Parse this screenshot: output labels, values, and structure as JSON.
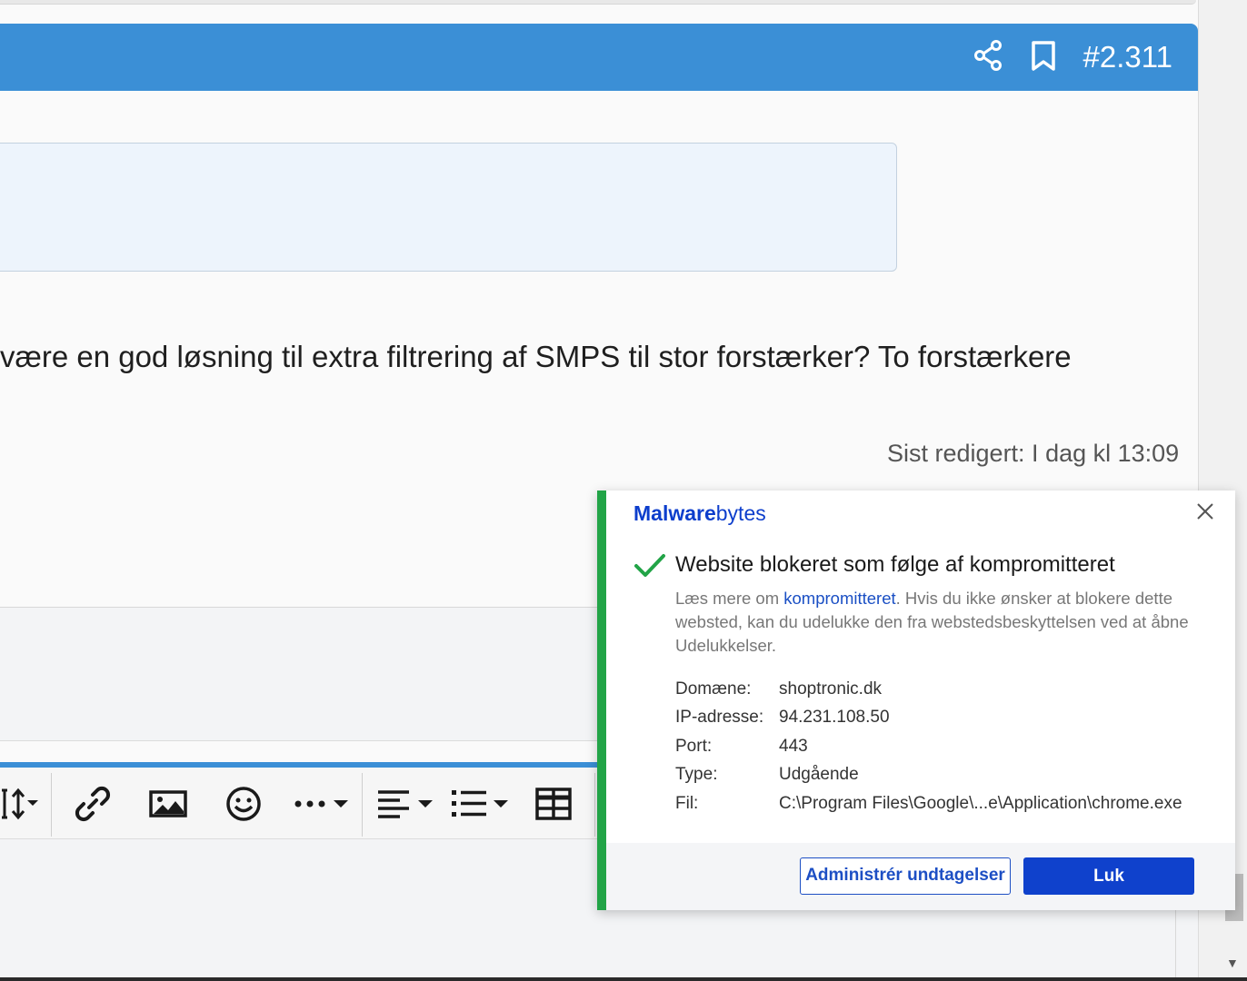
{
  "post": {
    "number": "#2.311",
    "body_text": "være en god løsning til extra filtrering af SMPS til stor forstærker? To forstærkere",
    "edited": "Sist redigert: I dag kl 13:09"
  },
  "editor_toolbar": {
    "icons": [
      "text-size-icon",
      "link-icon",
      "image-icon",
      "smiley-icon",
      "more-icon",
      "align-icon",
      "list-icon",
      "table-icon"
    ]
  },
  "popup": {
    "brand_bold": "Malware",
    "brand_light": "bytes",
    "title": "Website blokeret som følge af kompromitteret",
    "desc_prefix": "Læs mere om ",
    "desc_link": "kompromitteret",
    "desc_suffix": ". Hvis du ikke ønsker at blokere dette websted, kan du udelukke den fra webstedsbeskyttelsen ved at åbne Udelukkelser.",
    "details": [
      {
        "label": "Domæne:",
        "value": "shoptronic.dk"
      },
      {
        "label": "IP-adresse:",
        "value": "94.231.108.50"
      },
      {
        "label": "Port:",
        "value": "443"
      },
      {
        "label": "Type:",
        "value": "Udgående"
      },
      {
        "label": "Fil:",
        "value": "C:\\Program Files\\Google\\...e\\Application\\chrome.exe"
      }
    ],
    "manage_button": "Administrér undtagelser",
    "close_button": "Luk",
    "accent_color": "#22a447",
    "brand_color": "#0f41cc"
  }
}
